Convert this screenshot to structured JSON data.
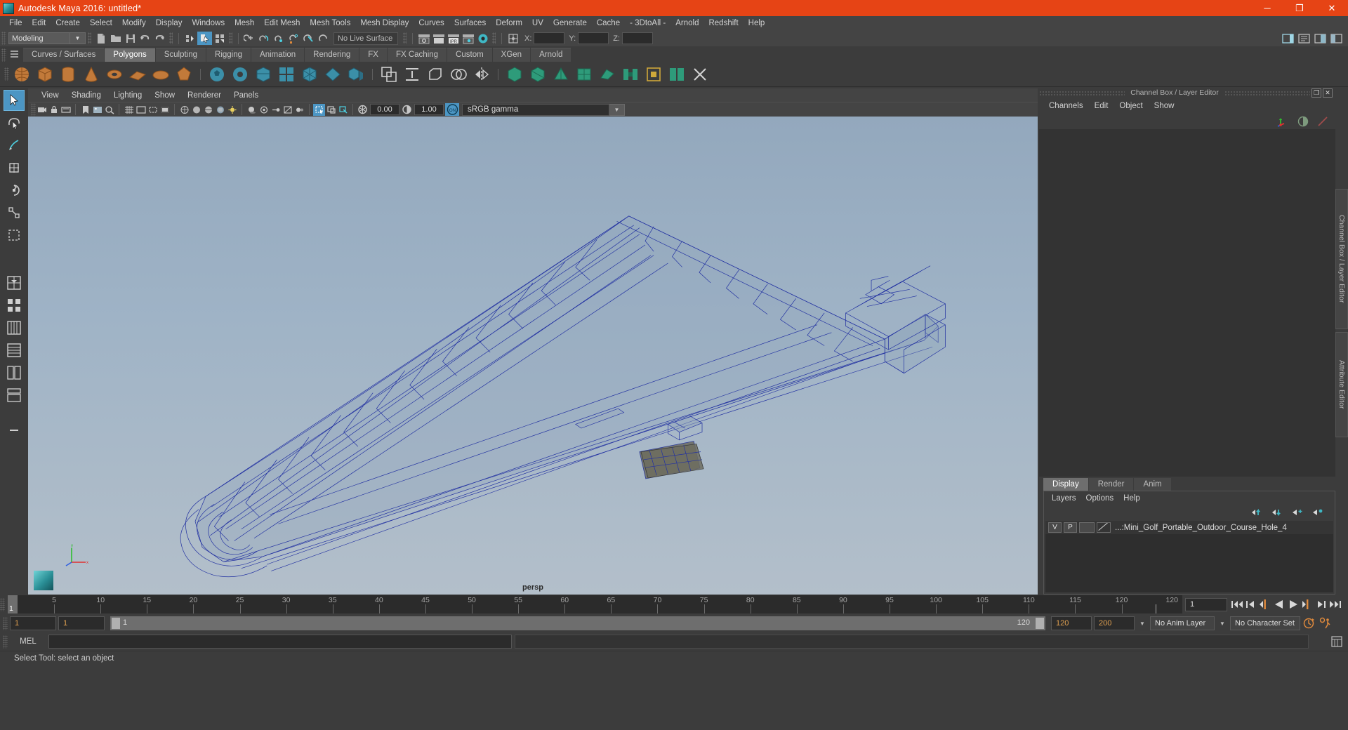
{
  "window": {
    "title": "Autodesk Maya 2016: untitled*",
    "logo_icon": "maya-logo-icon",
    "minimize_label": "─",
    "maximize_label": "❐",
    "close_label": "✕"
  },
  "menubar": {
    "items": [
      {
        "label": "File"
      },
      {
        "label": "Edit"
      },
      {
        "label": "Create"
      },
      {
        "label": "Select"
      },
      {
        "label": "Modify"
      },
      {
        "label": "Display"
      },
      {
        "label": "Windows"
      },
      {
        "label": "Mesh"
      },
      {
        "label": "Edit Mesh"
      },
      {
        "label": "Mesh Tools"
      },
      {
        "label": "Mesh Display"
      },
      {
        "label": "Curves"
      },
      {
        "label": "Surfaces"
      },
      {
        "label": "Deform"
      },
      {
        "label": "UV"
      },
      {
        "label": "Generate"
      },
      {
        "label": "Cache"
      },
      {
        "label": "- 3DtoAll -"
      },
      {
        "label": "Arnold"
      },
      {
        "label": "Redshift"
      },
      {
        "label": "Help"
      }
    ]
  },
  "statusbar": {
    "mode_selector": "Modeling",
    "mode_arrow_icon": "chevron-down-icon",
    "live_surface": "No Live Surface",
    "x_label": "X:",
    "y_label": "Y:",
    "z_label": "Z:",
    "x_value": "",
    "y_value": "",
    "z_value": "",
    "icons": [
      "new-scene-icon",
      "open-scene-icon",
      "save-scene-icon",
      "undo-icon",
      "redo-icon",
      "select-hierarchy-icon",
      "select-object-icon",
      "select-component-icon",
      "snap-grid-icon",
      "snap-curve-icon",
      "snap-point-icon",
      "snap-projected-icon",
      "snap-view-plane-icon",
      "make-live-icon",
      "render-view-icon",
      "render-frame-icon",
      "ipr-render-icon",
      "render-settings-icon",
      "hypershade-icon",
      "transform-tool-icon"
    ],
    "right_icons": [
      "sidebar-toggle-icon",
      "attribute-editor-icon",
      "channel-box-icon",
      "tool-settings-icon"
    ]
  },
  "shelf": {
    "hamburger_icon": "shelf-menu-icon",
    "tabs": [
      {
        "label": "Curves / Surfaces",
        "selected": false
      },
      {
        "label": "Polygons",
        "selected": true
      },
      {
        "label": "Sculpting",
        "selected": false
      },
      {
        "label": "Rigging",
        "selected": false
      },
      {
        "label": "Animation",
        "selected": false
      },
      {
        "label": "Rendering",
        "selected": false
      },
      {
        "label": "FX",
        "selected": false
      },
      {
        "label": "FX Caching",
        "selected": false
      },
      {
        "label": "Custom",
        "selected": false
      },
      {
        "label": "XGen",
        "selected": false
      },
      {
        "label": "Arnold",
        "selected": false
      }
    ],
    "tool_icons": [
      "poly-sphere-icon",
      "poly-cube-icon",
      "poly-cylinder-icon",
      "poly-cone-icon",
      "poly-torus-icon",
      "poly-plane-icon",
      "poly-disc-icon",
      "poly-platonic-icon",
      "poly-soccer-icon",
      "poly-pipe-icon",
      "poly-helix-icon",
      "poly-gear-icon",
      "poly-prism-icon",
      "poly-pyramid-icon",
      "poly-extrude-icon",
      "poly-combine-icon",
      "poly-separate-icon",
      "poly-bevel-icon",
      "poly-booleans-icon",
      "poly-mirror-icon",
      "poly-smooth-icon",
      "poly-reduce-icon",
      "poly-triangulate-icon",
      "poly-quadrangulate-icon",
      "poly-append-icon",
      "poly-bridge-icon",
      "poly-fill-hole-icon",
      "poly-crease-icon",
      "poly-cut-icon"
    ]
  },
  "toolbox": {
    "tools": [
      {
        "name": "select-tool-icon",
        "selected": true
      },
      {
        "name": "lasso-select-tool-icon",
        "selected": false
      },
      {
        "name": "paint-select-tool-icon",
        "selected": false
      },
      {
        "name": "move-tool-icon",
        "selected": false
      },
      {
        "name": "rotate-tool-icon",
        "selected": false
      },
      {
        "name": "scale-tool-icon",
        "selected": false
      },
      {
        "name": "last-tool-icon",
        "selected": false
      },
      {
        "name": "single-view-layout-icon",
        "selected": false
      },
      {
        "name": "two-pane-layout-icon",
        "selected": false
      },
      {
        "name": "four-pane-layout-icon",
        "selected": false
      },
      {
        "name": "persp-outliner-layout-icon",
        "selected": false
      },
      {
        "name": "hypershade-layout-icon",
        "selected": false
      },
      {
        "name": "outliner-layout-icon",
        "selected": false
      },
      {
        "name": "more-layouts-icon",
        "selected": false
      }
    ]
  },
  "viewport": {
    "panel_menu": [
      {
        "label": "View"
      },
      {
        "label": "Shading"
      },
      {
        "label": "Lighting"
      },
      {
        "label": "Show"
      },
      {
        "label": "Renderer"
      },
      {
        "label": "Panels"
      }
    ],
    "camera_label": "persp",
    "exposure_value": "0.00",
    "gamma_value": "1.00",
    "color_profile": "sRGB gamma",
    "color_profile_arrow_icon": "chevron-down-icon",
    "gamma_toggle_label": "ON",
    "axis_gizmo_icon": "axis-gizmo-icon",
    "viewport_logo_icon": "maya-viewport-logo-icon",
    "toolbar_icons": [
      "select-camera-icon",
      "lock-camera-icon",
      "camera-attributes-icon",
      "bookmark-icon",
      "image-plane-icon",
      "two-d-pan-zoom-icon",
      "grid-toggle-icon",
      "film-gate-icon",
      "resolution-gate-icon",
      "gate-mask-icon",
      "wireframe-icon",
      "smooth-shade-icon",
      "shaded-wireframe-icon",
      "textured-icon",
      "lighting-icon",
      "shadows-icon",
      "screen-space-ao-icon",
      "motion-blur-icon",
      "multisample-icon",
      "depth-of-field-icon",
      "xray-icon",
      "xray-joints-icon",
      "xray-active-components-icon",
      "exposure-icon",
      "contrast-icon",
      "gamma-on-icon"
    ],
    "model": {
      "name": "Mini Golf Portable Outdoor Course Hole 4",
      "wireframe_color": "#1b2aa0",
      "shading": "wireframe"
    }
  },
  "right_panel": {
    "title": "Channel Box / Layer Editor",
    "undock_icon": "undock-icon",
    "close_icon": "close-icon",
    "channel_menu": [
      {
        "label": "Channels"
      },
      {
        "label": "Edit"
      },
      {
        "label": "Object"
      },
      {
        "label": "Show"
      }
    ],
    "header_icons": [
      "transform-channels-icon",
      "shapes-channels-icon",
      "outputs-channels-icon"
    ],
    "vertical_tabs": [
      "Channel Box / Layer Editor",
      "Attribute Editor"
    ],
    "layer_tabs": [
      {
        "label": "Display",
        "selected": true
      },
      {
        "label": "Render",
        "selected": false
      },
      {
        "label": "Anim",
        "selected": false
      }
    ],
    "layer_menu": [
      {
        "label": "Layers"
      },
      {
        "label": "Options"
      },
      {
        "label": "Help"
      }
    ],
    "layer_buttons": [
      "move-layer-up-icon",
      "move-layer-down-icon",
      "new-layer-icon",
      "new-layer-from-selected-icon"
    ],
    "layers": [
      {
        "visibility": "V",
        "playback": "P",
        "color_swatch": "",
        "shading_icon": "layer-shading-icon",
        "name": "...:Mini_Golf_Portable_Outdoor_Course_Hole_4"
      }
    ]
  },
  "timeline": {
    "current_frame_marker": "1",
    "ticks": [
      5,
      10,
      15,
      20,
      25,
      30,
      35,
      40,
      45,
      50,
      55,
      60,
      65,
      70,
      75,
      80,
      85,
      90,
      95,
      100,
      105,
      110,
      115,
      120
    ],
    "range_end_label": "120",
    "current_frame_field": "1",
    "playback_buttons": [
      "go-to-start-icon",
      "step-back-keyframe-icon",
      "step-back-frame-icon",
      "play-backwards-icon",
      "play-forwards-icon",
      "step-forward-frame-icon",
      "step-forward-keyframe-icon",
      "go-to-end-icon"
    ]
  },
  "range_slider": {
    "anim_start": "1",
    "range_start": "1",
    "slider_start_label": "1",
    "slider_end_label": "120",
    "range_end": "120",
    "anim_end": "200",
    "anim_layer": "No Anim Layer",
    "character_set": "No Character Set",
    "auto_key_icon": "auto-keyframe-icon",
    "anim_prefs_icon": "animation-preferences-icon",
    "anim_layer_arrow_icon": "chevron-down-icon",
    "char_set_arrow_icon": "chevron-down-icon"
  },
  "command_line": {
    "label": "MEL",
    "input_value": "",
    "output_value": "",
    "script_editor_icon": "script-editor-icon"
  },
  "status_line": {
    "message": "Select Tool: select an object"
  },
  "colors": {
    "title_bar": "#e64415",
    "accent_blue": "#4c96c4",
    "panel_bg": "#3c3c3c",
    "field_bg": "#2b2b2b",
    "orange_value": "#e0a050",
    "wire_blue": "#1b2aa0"
  }
}
